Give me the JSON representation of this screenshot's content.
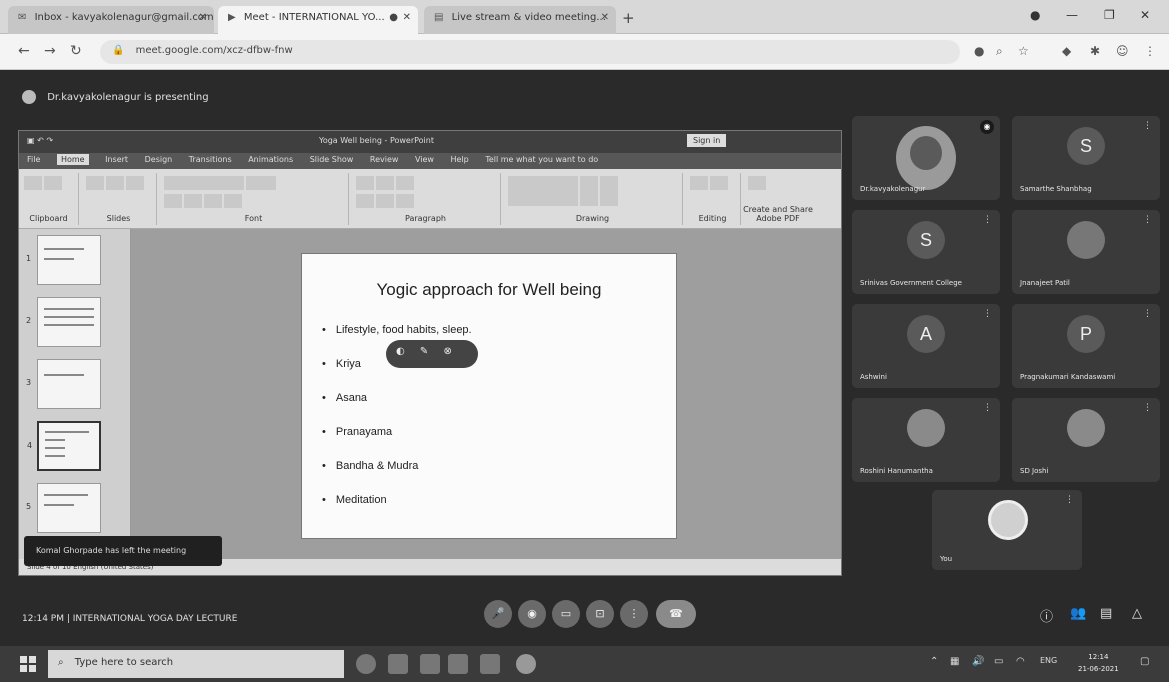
{
  "browser": {
    "tabs": [
      {
        "label": "Inbox - kavyakolenagur@gmail.com",
        "icon": "gmail-icon"
      },
      {
        "label": "Meet - INTERNATIONAL YO...",
        "icon": "meet-icon"
      },
      {
        "label": "Live stream & video meeting...",
        "icon": "page-icon"
      }
    ],
    "url": "meet.google.com/xcz-dfbw-fnw"
  },
  "meet": {
    "host_title": "Dr.kavyakolenagur is presenting",
    "meeting_info": "12:14 PM  |  INTERNATIONAL YOGA DAY LECTURE",
    "toast": "Komal Ghorpade has left the meeting"
  },
  "ppt": {
    "window_title": "Yoga Well being  -  PowerPoint",
    "signin": "Sign in",
    "menu": [
      "File",
      "Home",
      "Insert",
      "Design",
      "Transitions",
      "Animations",
      "Slide Show",
      "Review",
      "View",
      "Help",
      "Tell me what you want to do"
    ],
    "ribbon_groups": [
      "Clipboard",
      "Slides",
      "Font",
      "Paragraph",
      "Drawing",
      "Editing",
      "Create and Share Adobe PDF"
    ],
    "status": "Slide 4 of 10    English (United States)",
    "slide": {
      "title": "Yogic approach for Well being",
      "bullets": [
        "Lifestyle, food habits, sleep.",
        "Kriya",
        "Asana",
        "Pranayama",
        "Bandha & Mudra",
        "Meditation"
      ]
    }
  },
  "participants": [
    {
      "name": "Dr.kavyakolenagur",
      "type": "video",
      "speaking": true
    },
    {
      "name": "Samarthe Shanbhag",
      "initial": "S"
    },
    {
      "name": "Srinivas Government College",
      "initial": "S"
    },
    {
      "name": "Jnanajeet Patil",
      "type": "photo"
    },
    {
      "name": "Ashwini",
      "initial": "A"
    },
    {
      "name": "Pragnakumari Kandaswami",
      "initial": "P"
    },
    {
      "name": "Roshini Hanumantha",
      "type": "photo"
    },
    {
      "name": "SD Joshi",
      "type": "photo"
    },
    {
      "name": "You",
      "type": "video-self"
    }
  ],
  "taskbar": {
    "search_placeholder": "Type here to search",
    "lang": "ENG",
    "time": "12:14",
    "date": "21-06-2021"
  }
}
